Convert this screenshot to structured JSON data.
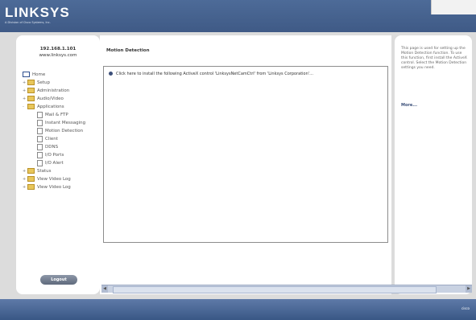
{
  "header": {
    "logo": "LINKSYS",
    "logo_sub": "A Division of Cisco Systems, Inc."
  },
  "left_panel": {
    "host_ip": "192.168.1.101",
    "host_name": "www.linksys.com",
    "tree": [
      {
        "label": "Home",
        "level": 0,
        "icon": "home-icon"
      },
      {
        "label": "Setup",
        "level": 1,
        "icon": "folder-icon",
        "expand": "+"
      },
      {
        "label": "Administration",
        "level": 1,
        "icon": "folder-icon",
        "expand": "+"
      },
      {
        "label": "Audio/Video",
        "level": 1,
        "icon": "folder-icon",
        "expand": "+"
      },
      {
        "label": "Applications",
        "level": 1,
        "icon": "folder-icon",
        "expand": "-"
      },
      {
        "label": "Mail & FTP",
        "level": 2,
        "icon": "page-icon"
      },
      {
        "label": "Instant Messaging",
        "level": 2,
        "icon": "page-icon"
      },
      {
        "label": "Motion Detection",
        "level": 2,
        "icon": "page-icon"
      },
      {
        "label": "Client",
        "level": 2,
        "icon": "page-icon"
      },
      {
        "label": "DDNS",
        "level": 2,
        "icon": "page-icon"
      },
      {
        "label": "I/O Ports",
        "level": 2,
        "icon": "page-icon"
      },
      {
        "label": "I/O Alert",
        "level": 2,
        "icon": "page-icon"
      },
      {
        "label": "Status",
        "level": 1,
        "icon": "folder-icon",
        "expand": "+"
      },
      {
        "label": "View Video Log",
        "level": 1,
        "icon": "folder-icon",
        "expand": "+"
      },
      {
        "label": "View Video Log",
        "level": 1,
        "icon": "folder-icon",
        "expand": "+"
      }
    ],
    "logout_label": "Logout"
  },
  "main": {
    "title": "Motion Detection",
    "notice": "Click here to install the following ActiveX control 'LinksysNetCamCtrl' from 'Linksys Corporation'..."
  },
  "right_panel": {
    "help_text": "This page is used for setting up the Motion Detection function. To use this function, first install the ActiveX control. Select the Motion Detection settings you need.",
    "more_label": "More..."
  },
  "footer": {
    "brand": "cisco"
  }
}
